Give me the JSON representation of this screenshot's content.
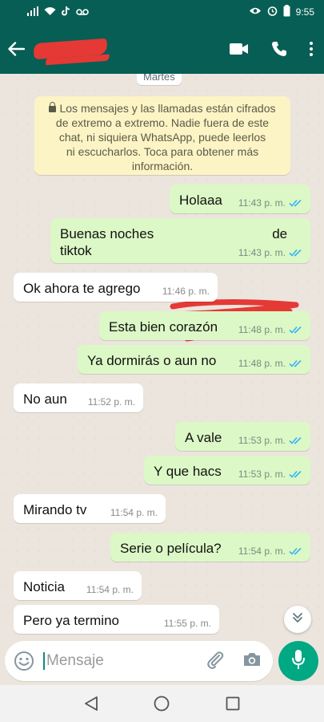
{
  "status_bar": {
    "time": "9:55"
  },
  "header": {
    "back_icon": "arrow-left-icon",
    "video_icon": "video-camera-icon",
    "call_icon": "phone-icon",
    "menu_icon": "more-vertical-icon"
  },
  "date_chip": "Martes",
  "notice": {
    "line1": "Los mensajes y las llamadas están cifrados",
    "line2": "de extremo a extremo. Nadie fuera de este",
    "line3": "chat, ni siquiera WhatsApp, puede leerlos",
    "line4": "ni escucharlos. Toca para obtener más",
    "line5": "información."
  },
  "messages": [
    {
      "dir": "out",
      "text": "Holaaa",
      "time": "11:43 p. m."
    },
    {
      "dir": "out",
      "text_line1": "Buenas noches",
      "text_line1_end": "de",
      "text_line2": "tiktok",
      "time": "11:43 p. m."
    },
    {
      "dir": "in",
      "text": "Ok ahora te agrego",
      "time": "11:46 p. m."
    },
    {
      "dir": "out",
      "text": "Esta bien corazón",
      "time": "11:48 p. m."
    },
    {
      "dir": "out",
      "text": "Ya dormirás o aun no",
      "time": "11:48 p. m."
    },
    {
      "dir": "in",
      "text": "No aun",
      "time": "11:52 p. m."
    },
    {
      "dir": "out",
      "text": "A vale",
      "time": "11:53 p. m."
    },
    {
      "dir": "out",
      "text": "Y que hacs",
      "time": "11:53 p. m."
    },
    {
      "dir": "in",
      "text": "Mirando tv",
      "time": "11:54 p. m."
    },
    {
      "dir": "out",
      "text": "Serie o película?",
      "time": "11:54 p. m."
    },
    {
      "dir": "in",
      "text": "Noticia",
      "time": "11:54 p. m."
    },
    {
      "dir": "in",
      "text": "Pero ya termino",
      "time": "11:55 p. m."
    }
  ],
  "composer": {
    "placeholder": "Mensaje"
  },
  "colors": {
    "header": "#075e54",
    "outgoing": "#dcf8c6",
    "incoming": "#ffffff",
    "ticks": "#34b7f1",
    "mic": "#00a884"
  }
}
